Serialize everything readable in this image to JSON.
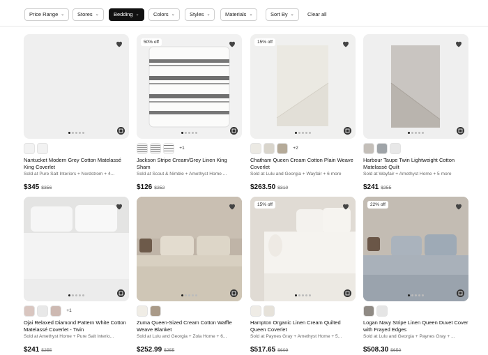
{
  "filters": {
    "price_range": "Price Range",
    "stores": "Stores",
    "bedding": "Bedding",
    "colors": "Colors",
    "styles": "Styles",
    "materials": "Materials",
    "sort_by": "Sort By",
    "clear_all": "Clear all",
    "active_filter": "Bedding"
  },
  "products": [
    {
      "title": "Nantucket Modern Grey Cotton Matelassé King Coverlet",
      "sold": "Sold at Pure Salt Interiors + Nordstrom + 4...",
      "price": "$345",
      "original_price": "$356",
      "badge": "",
      "thumbs_more": ""
    },
    {
      "title": "Jackson Stripe Cream/Grey Linen King Sham",
      "sold": "Sold at Scout & Nimble + Amethyst Home ...",
      "price": "$126",
      "original_price": "$252",
      "badge": "50% off",
      "thumbs_more": "+1"
    },
    {
      "title": "Chatham Queen Cream Cotton Plain Weave Coverlet",
      "sold": "Sold at Lulu and Georgia + Wayfair + 6 more",
      "price": "$263.50",
      "original_price": "$310",
      "badge": "15% off",
      "thumbs_more": "+2"
    },
    {
      "title": "Harbour Taupe Twin Lightweight Cotton Matelassé Quilt",
      "sold": "Sold at Wayfair + Amethyst Home + 5 more",
      "price": "$241",
      "original_price": "$255",
      "badge": "",
      "thumbs_more": ""
    },
    {
      "title": "Ojai Relaxed Diamond Pattern White Cotton Matelassé Coverlet - Twin",
      "sold": "Sold at Amethyst Home + Pure Salt Interio...",
      "price": "$241",
      "original_price": "$255",
      "badge": "",
      "thumbs_more": "+1"
    },
    {
      "title": "Zuma Queen-Sized Cream Cotton Waffle Weave Blanket",
      "sold": "Sold at Lulu and Georgia + Zola Home + 6...",
      "price": "$252.99",
      "original_price": "$255",
      "badge": "",
      "thumbs_more": ""
    },
    {
      "title": "Hampton Organic Linen Cream Quilted Queen Coverlet",
      "sold": "Sold at Paynes Gray + Amethyst Home + 5...",
      "price": "$517.65",
      "original_price": "$609",
      "badge": "15% off",
      "thumbs_more": ""
    },
    {
      "title": "Logan Navy Stripe Linen Queen Duvet Cover with Frayed Edges",
      "sold": "Sold at Lulu and Georgia + Paynes Gray + ...",
      "price": "$508.30",
      "original_price": "$650",
      "badge": "22% off",
      "thumbs_more": ""
    }
  ],
  "icons": {
    "chevron": "chevron-down-icon",
    "heart": "heart-icon",
    "edit": "edit-icon"
  },
  "colors": {
    "active_chip": "#111111",
    "image_bg": "#f0f0f0"
  }
}
